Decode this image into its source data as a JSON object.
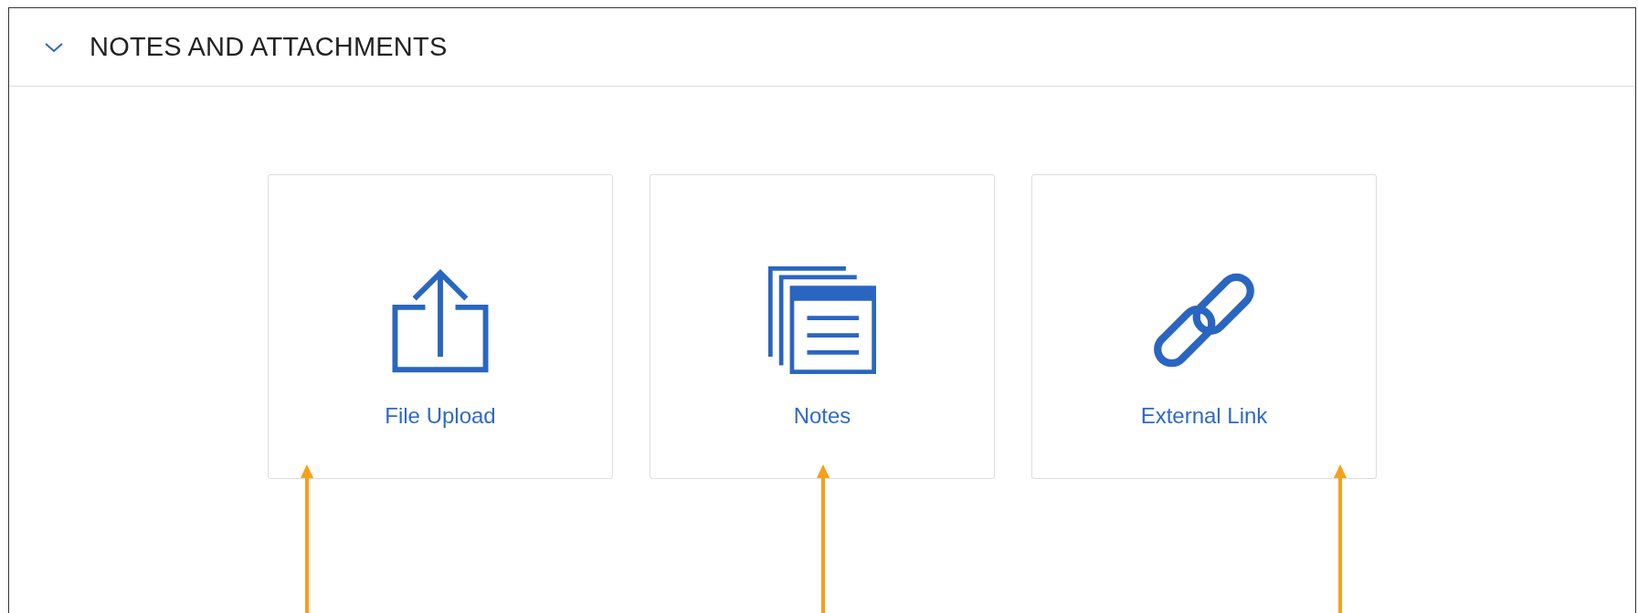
{
  "section": {
    "title": "NOTES AND ATTACHMENTS",
    "expanded": true
  },
  "options": [
    {
      "kind": "upload",
      "label": "File Upload",
      "annotated": true
    },
    {
      "kind": "notes",
      "label": "Notes",
      "annotated": true
    },
    {
      "kind": "link",
      "label": "External Link",
      "annotated": true
    }
  ]
}
